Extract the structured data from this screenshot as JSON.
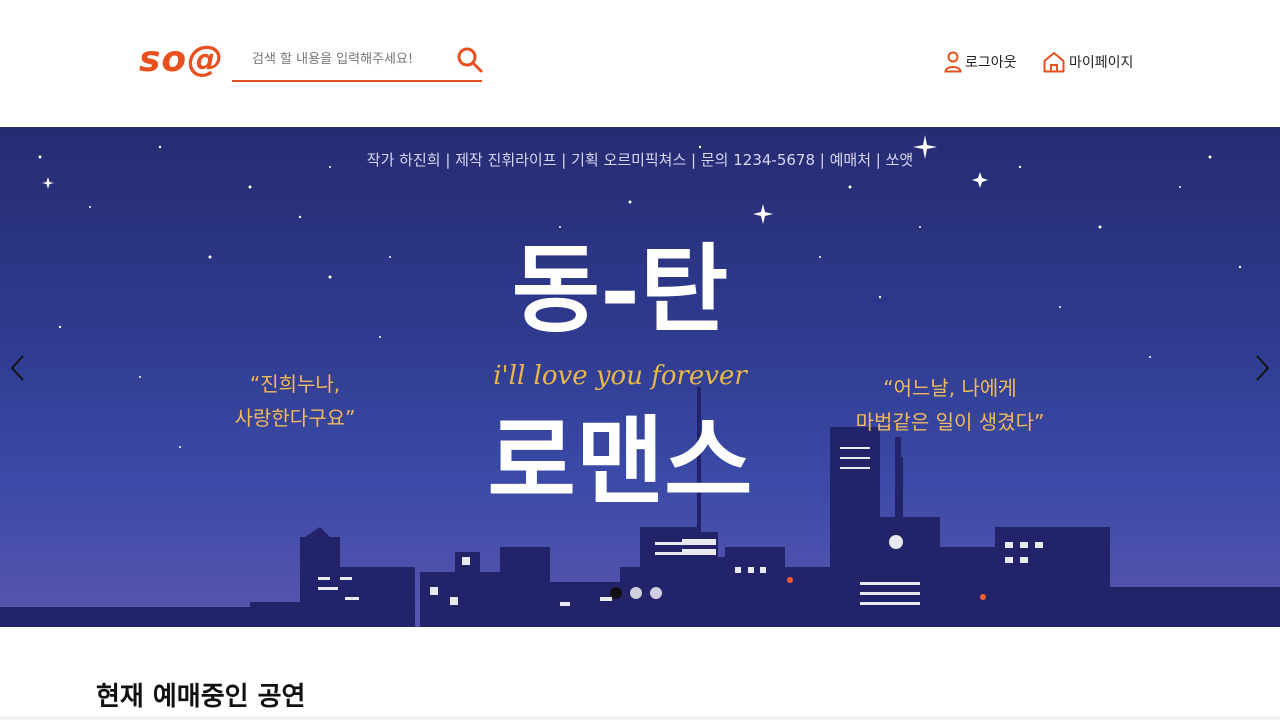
{
  "header": {
    "logo": "so@",
    "search": {
      "placeholder": "검색 할 내용을 입력해주세요!"
    },
    "nav": {
      "logout": "로그아웃",
      "mypage": "마이페이지"
    }
  },
  "banner": {
    "credits": "작가 하진희 | 제작 진휘라이프 | 기획 오르미픽쳐스 | 문의 1234-5678  | 예매처 | 쏘앳",
    "title_line1": "동-탄",
    "title_line2": "로맨스",
    "tagline": "i'll love you forever",
    "quote_left": [
      "“진희누나,",
      "사랑한다구요”"
    ],
    "quote_right": [
      "“어느날, 나에게",
      "마법같은 일이 생겼다”"
    ],
    "slide_count": 3,
    "active_slide": 1
  },
  "main": {
    "section_title": "현재 예매중인 공연"
  },
  "colors": {
    "accent": "#e8511f",
    "banner_top": "#262c72",
    "banner_bottom": "#5a56b0",
    "quote": "#f0b95a"
  }
}
